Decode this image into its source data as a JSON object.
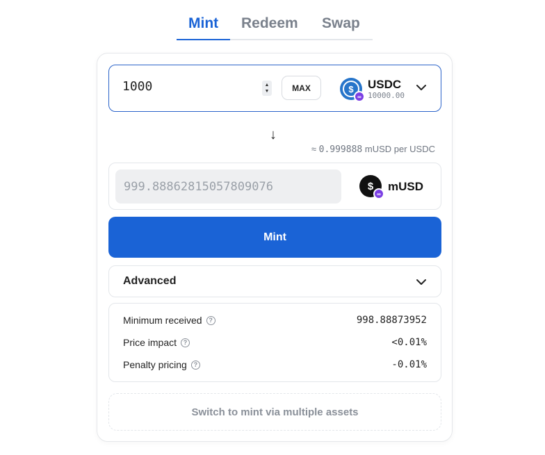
{
  "tabs": [
    {
      "label": "Mint",
      "active": true
    },
    {
      "label": "Redeem",
      "active": false
    },
    {
      "label": "Swap",
      "active": false
    }
  ],
  "input": {
    "amount": "1000",
    "max_label": "MAX",
    "token_symbol": "USDC",
    "token_balance": "10000.00",
    "token_icon": "usdc-coin-icon"
  },
  "arrow_glyph": "↓",
  "rate": {
    "prefix": "≈",
    "value": "0.999888",
    "unit": " mUSD per USDC"
  },
  "output": {
    "amount": "999.88862815057809076",
    "token_symbol": "mUSD",
    "token_icon": "musd-coin-icon"
  },
  "mint_button_label": "Mint",
  "advanced_label": "Advanced",
  "details": {
    "minimum_received": {
      "label": "Minimum received",
      "value": "998.88873952"
    },
    "price_impact": {
      "label": "Price impact",
      "value": "<0.01%"
    },
    "penalty_pricing": {
      "label": "Penalty pricing",
      "value": "-0.01%"
    }
  },
  "switch_label": "Switch to mint via multiple assets",
  "colors": {
    "accent": "#1a63d6",
    "usdc": "#2775ca",
    "chain_badge": "#7b3fe4"
  }
}
